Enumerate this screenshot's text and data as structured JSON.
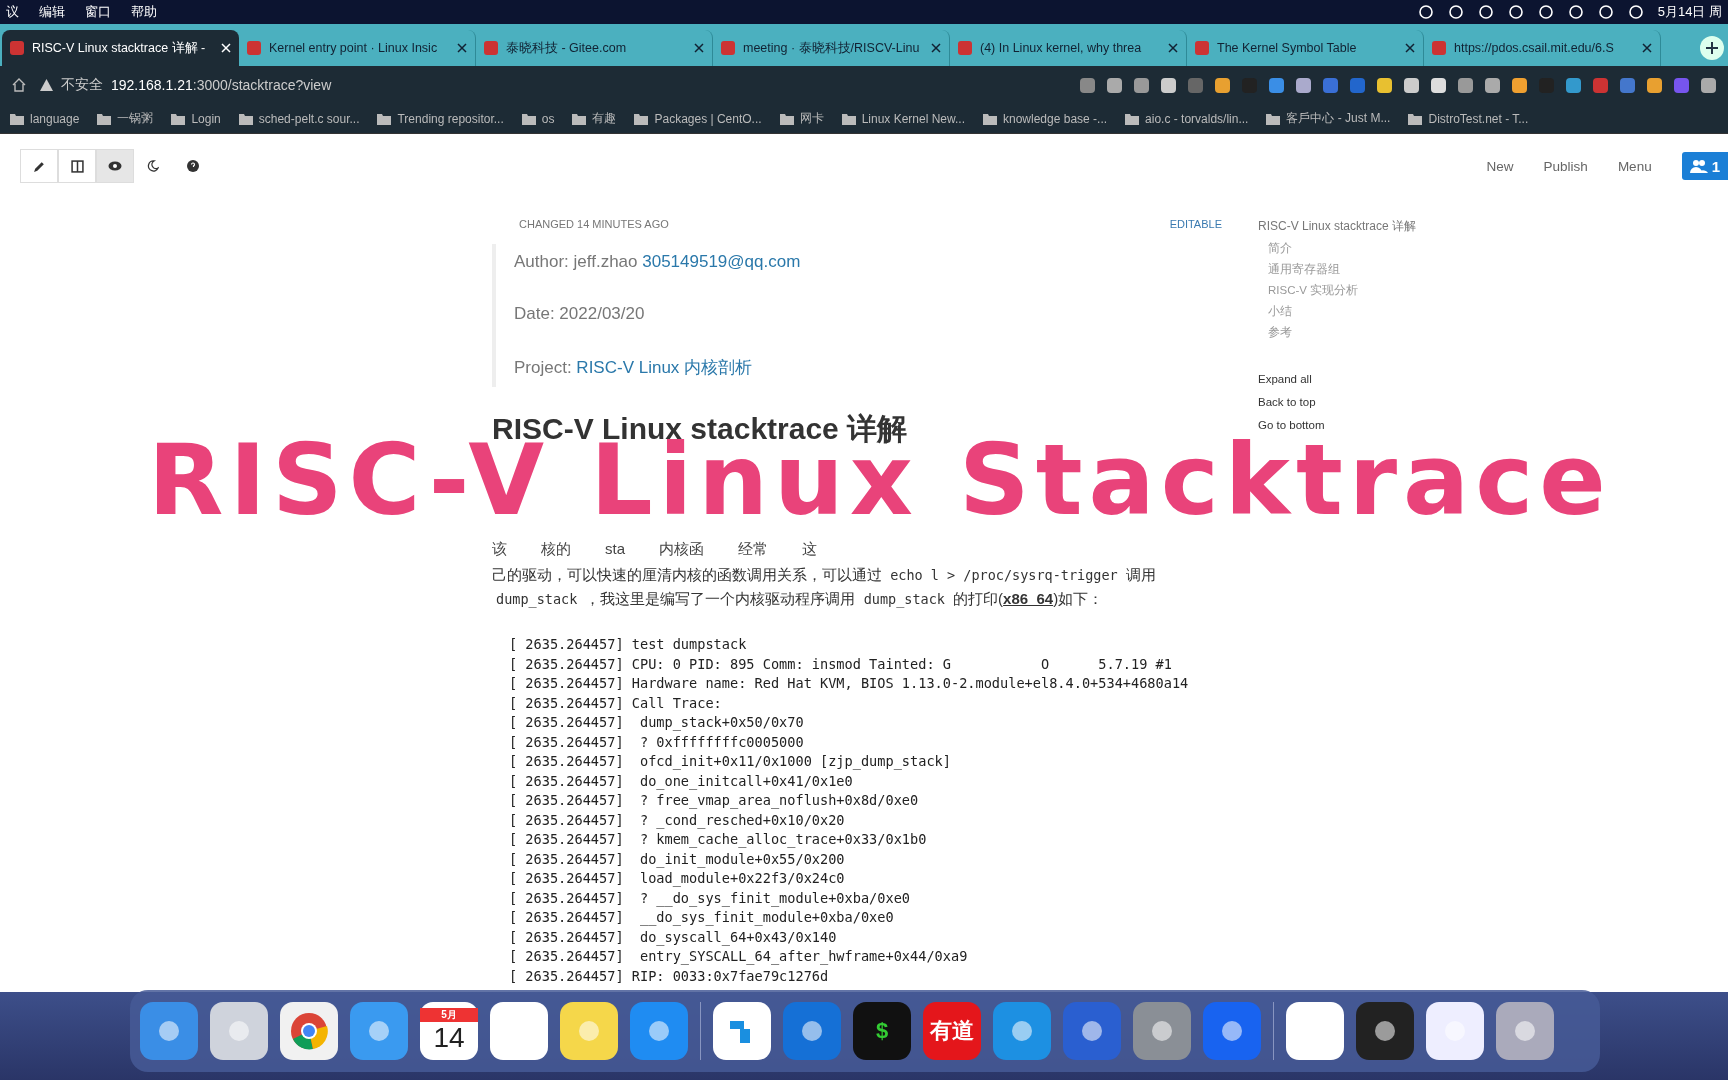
{
  "menubar": {
    "items": [
      "议",
      "编辑",
      "窗口",
      "帮助"
    ],
    "clock": "5月14日 周"
  },
  "tabs": [
    {
      "title": "RISC-V Linux stacktrace 详解 -",
      "selected": true
    },
    {
      "title": "Kernel entry point · Linux Insic",
      "selected": false
    },
    {
      "title": "泰晓科技 - Gitee.com",
      "selected": false
    },
    {
      "title": "meeting · 泰晓科技/RISCV-Linu",
      "selected": false
    },
    {
      "title": "(4) In Linux kernel, why threa",
      "selected": false
    },
    {
      "title": "The Kernel Symbol Table",
      "selected": false
    },
    {
      "title": "https://pdos.csail.mit.edu/6.S",
      "selected": false
    }
  ],
  "address": {
    "security": "不安全",
    "host": "192.168.1.21",
    "path": ":3000/stacktrace?view"
  },
  "bookmarks": [
    "language",
    "一锅粥",
    "Login",
    "sched-pelt.c sour...",
    "Trending repositor...",
    "os",
    "有趣",
    "Packages | CentO...",
    "网卡",
    "Linux Kernel New...",
    "knowledge base -...",
    "aio.c - torvalds/lin...",
    "客戶中心 - Just M...",
    "DistroTest.net - T..."
  ],
  "editor_toolbar": {
    "modes": [
      {
        "kind": "edit",
        "selected": false
      },
      {
        "kind": "split",
        "selected": false
      },
      {
        "kind": "view",
        "selected": true
      },
      {
        "kind": "night",
        "selected": false
      },
      {
        "kind": "help",
        "selected": false
      }
    ],
    "actions": [
      "New",
      "Publish",
      "Menu"
    ],
    "online_count": "1"
  },
  "doc": {
    "changed": "CHANGED 14 MINUTES AGO",
    "permission": "EDITABLE",
    "meta": [
      {
        "label": "Author: ",
        "text": "jeff.zhao ",
        "link": "305149519@qq.com"
      },
      {
        "label": "Date: ",
        "text": "2022/03/20"
      },
      {
        "label": "Project: ",
        "link": "RISC-V Linux 内核剖析"
      }
    ],
    "title": "RISC-V Linux stacktrace 详解",
    "covered_line": [
      "该",
      "核的",
      "sta",
      "内核函",
      "经常",
      "这"
    ],
    "paragraph": [
      {
        "kind": "text",
        "text": "己的驱动，可以快速的厘清内核的函数调用关系，可以通过 "
      },
      {
        "kind": "code",
        "text": "echo l > /proc/sysrq-trigger"
      },
      {
        "kind": "text",
        "text": " 调用 "
      },
      {
        "kind": "code",
        "text": "dump_stack"
      },
      {
        "kind": "text",
        "text": " ，我这里是编写了一个内核驱动程序调用 "
      },
      {
        "kind": "code",
        "text": "dump_stack"
      },
      {
        "kind": "text",
        "text": " 的打印("
      },
      {
        "kind": "bold",
        "text": "x86_64"
      },
      {
        "kind": "text",
        "text": ")如下："
      }
    ],
    "code": [
      "[ 2635.264457] test dumpstack",
      "[ 2635.264457] CPU: 0 PID: 895 Comm: insmod Tainted: G           O      5.7.19 #1",
      "[ 2635.264457] Hardware name: Red Hat KVM, BIOS 1.13.0-2.module+el8.4.0+534+4680a14",
      "[ 2635.264457] Call Trace:",
      "[ 2635.264457]  dump_stack+0x50/0x70",
      "[ 2635.264457]  ? 0xffffffffc0005000",
      "[ 2635.264457]  ofcd_init+0x11/0x1000 [zjp_dump_stack]",
      "[ 2635.264457]  do_one_initcall+0x41/0x1e0",
      "[ 2635.264457]  ? free_vmap_area_noflush+0x8d/0xe0",
      "[ 2635.264457]  ? _cond_resched+0x10/0x20",
      "[ 2635.264457]  ? kmem_cache_alloc_trace+0x33/0x1b0",
      "[ 2635.264457]  do_init_module+0x55/0x200",
      "[ 2635.264457]  load_module+0x22f3/0x24c0",
      "[ 2635.264457]  ? __do_sys_finit_module+0xba/0xe0",
      "[ 2635.264457]  __do_sys_finit_module+0xba/0xe0",
      "[ 2635.264457]  do_syscall_64+0x43/0x140",
      "[ 2635.264457]  entry_SYSCALL_64_after_hwframe+0x44/0xa9",
      "[ 2635.264457] RIP: 0033:0x7fae79c1276d"
    ]
  },
  "toc": {
    "title": "RISC-V Linux stacktrace 详解",
    "items": [
      "简介",
      "通用寄存器组",
      "RISC-V 实现分析",
      "小结",
      "参考"
    ],
    "actions": [
      "Expand all",
      "Back to top",
      "Go to bottom"
    ]
  },
  "overlay_title": "RISC-V Linux Stacktrace",
  "dock": [
    {
      "kind": "finder"
    },
    {
      "kind": "launchpad"
    },
    {
      "kind": "chrome"
    },
    {
      "kind": "mail"
    },
    {
      "kind": "calendar",
      "month": "5月",
      "day": "14"
    },
    {
      "kind": "reminders"
    },
    {
      "kind": "notes"
    },
    {
      "kind": "appstore"
    },
    {
      "kind": "sep"
    },
    {
      "kind": "tiles"
    },
    {
      "kind": "teamviewer"
    },
    {
      "kind": "terminal",
      "text": "$"
    },
    {
      "kind": "youdao",
      "text": "有道"
    },
    {
      "kind": "docker"
    },
    {
      "kind": "parallels"
    },
    {
      "kind": "settings"
    },
    {
      "kind": "feishu"
    },
    {
      "kind": "sep"
    },
    {
      "kind": "document"
    },
    {
      "kind": "window"
    },
    {
      "kind": "window2"
    },
    {
      "kind": "trash"
    }
  ]
}
